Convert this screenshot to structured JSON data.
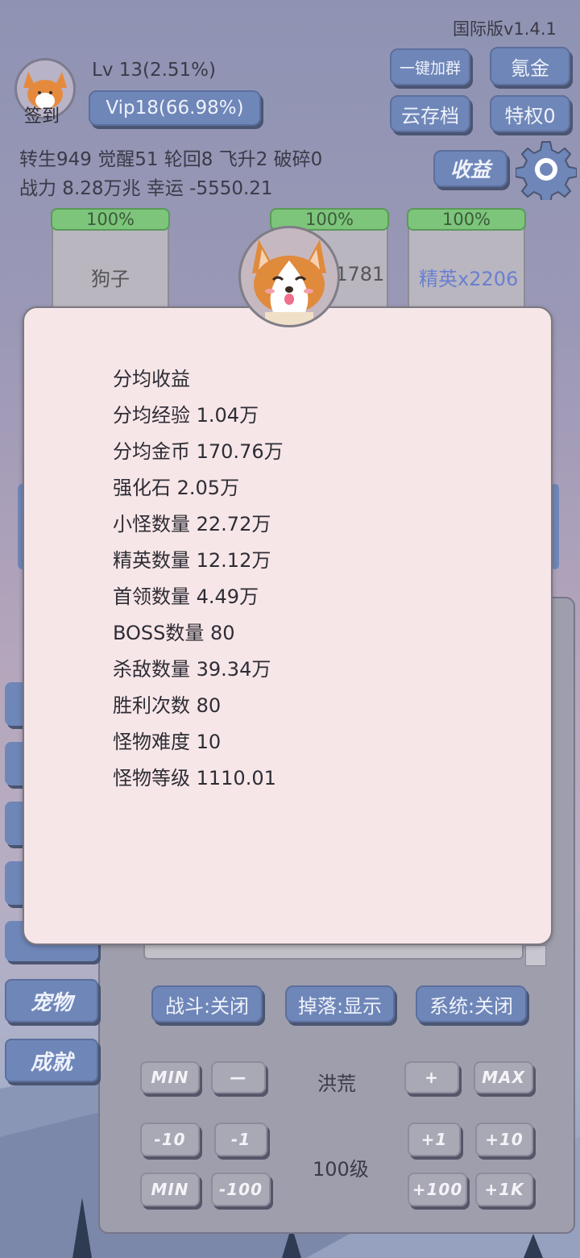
{
  "header": {
    "version": "国际版v1.4.1",
    "checkin_label": "签到",
    "level": "Lv 13(2.51%)",
    "vip": "Vip18(66.98%)",
    "stats_line1": "转生949 觉醒51 轮回8 飞升2 破碎0",
    "stats_line2": "战力 8.28万兆  幸运 -5550.21",
    "buttons": {
      "join_group": "一键加群",
      "recharge": "氪金",
      "cloud_save": "云存档",
      "privilege": "特权0",
      "income": "收益"
    }
  },
  "enemy_cards": [
    {
      "progress": "100%",
      "label": "狗子"
    },
    {
      "progress": "100%",
      "label": "x1781"
    },
    {
      "progress": "100%",
      "label": "精英x2206"
    }
  ],
  "income_popup": {
    "lines": [
      "分均收益",
      "分均经验 1.04万",
      "分均金币 170.76万",
      "强化石  2.05万",
      "小怪数量 22.72万",
      "精英数量 12.12万",
      "首领数量 4.49万",
      "BOSS数量 80",
      "杀敌数量  39.34万",
      "胜利次数  80",
      "怪物难度  10",
      "怪物等级  1110.01"
    ]
  },
  "sidebar": {
    "pet": "宠物",
    "achievement": "成就"
  },
  "toggles": {
    "battle": "战斗:关闭",
    "drop": "掉落:显示",
    "system": "系统:关闭"
  },
  "difficulty": {
    "min": "MIN",
    "minus": "—",
    "name": "洪荒",
    "plus": "+",
    "max": "MAX"
  },
  "level_select": {
    "minus10": "-10",
    "minus1": "-1",
    "value": "100级",
    "plus1": "+1",
    "plus10": "+10",
    "min": "MIN",
    "minus100": "-100",
    "plus100": "+100",
    "plus1k": "+1K"
  },
  "colors": {
    "button_blue": "#6f86b8",
    "progress_green": "#7cc57b",
    "popup_bg": "#f7e6e8"
  }
}
